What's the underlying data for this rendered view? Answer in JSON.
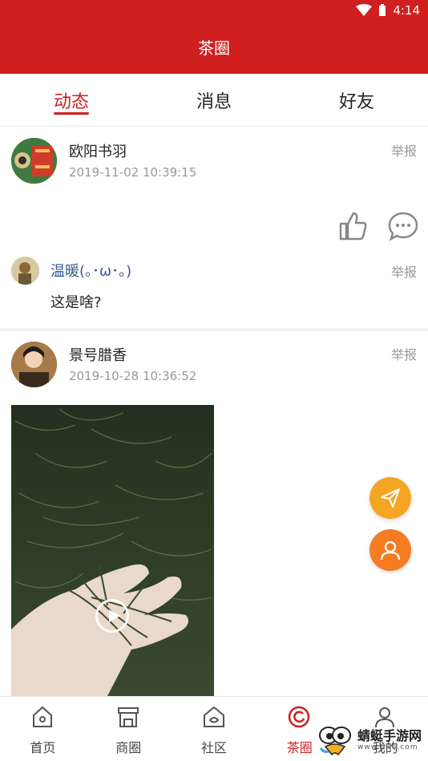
{
  "status_bar": {
    "time": "4:14"
  },
  "app_bar": {
    "title": "茶圈"
  },
  "tabs": [
    {
      "label": "动态",
      "active": true
    },
    {
      "label": "消息",
      "active": false
    },
    {
      "label": "好友",
      "active": false
    }
  ],
  "posts": [
    {
      "username": "欧阳书羽",
      "time": "2019-11-02 10:39:15",
      "report": "举报",
      "comment": {
        "username": "温暖(｡･ω･｡)",
        "text": "这是啥?",
        "report": "举报"
      }
    },
    {
      "username": "景号腊香",
      "time": "2019-10-28 10:36:52",
      "report": "举报"
    }
  ],
  "bottom_nav": [
    {
      "label": "首页",
      "icon": "home-icon"
    },
    {
      "label": "商圈",
      "icon": "shop-icon"
    },
    {
      "label": "社区",
      "icon": "community-icon"
    },
    {
      "label": "茶圈",
      "icon": "tea-circle-icon",
      "active": true
    },
    {
      "label": "我的",
      "icon": "user-icon"
    }
  ],
  "watermark": {
    "text": "蜻蜓手游网",
    "sub": "www.QT6.com"
  },
  "colors": {
    "brand_red": "#cf1f1f",
    "fab_orange": "#f4a623",
    "fab_orange2": "#f57c22"
  }
}
